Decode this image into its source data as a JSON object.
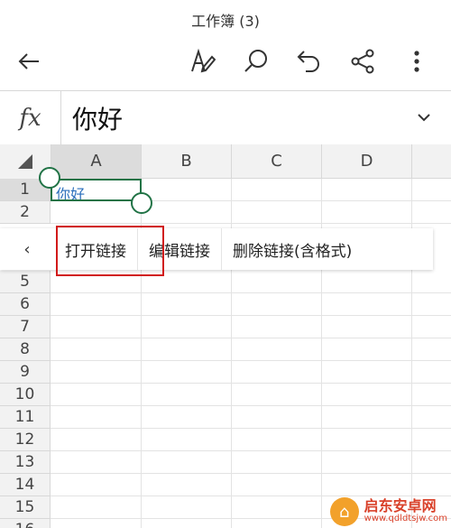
{
  "header": {
    "title": "工作簿 (3)",
    "icons": [
      "back-arrow-icon",
      "pen-edit-icon",
      "search-icon",
      "undo-icon",
      "share-icon",
      "more-vertical-icon"
    ]
  },
  "formula_bar": {
    "fx_label": "fx",
    "content": "你好"
  },
  "sheet": {
    "columns": [
      "A",
      "B",
      "C",
      "D"
    ],
    "rows": [
      "1",
      "2",
      "5",
      "6",
      "7",
      "8",
      "9",
      "10",
      "11",
      "12",
      "13",
      "14",
      "15",
      "16"
    ],
    "cell_a1": "你好",
    "selected_cell": "A1",
    "accent_color": "#217346",
    "link_color": "#2a6ebb"
  },
  "context_menu": {
    "prev_label": "‹",
    "items": [
      "打开链接",
      "编辑链接",
      "删除链接(含格式)"
    ]
  },
  "watermark": {
    "name": "启东安卓网",
    "url": "www.qdldtsjw.com"
  }
}
